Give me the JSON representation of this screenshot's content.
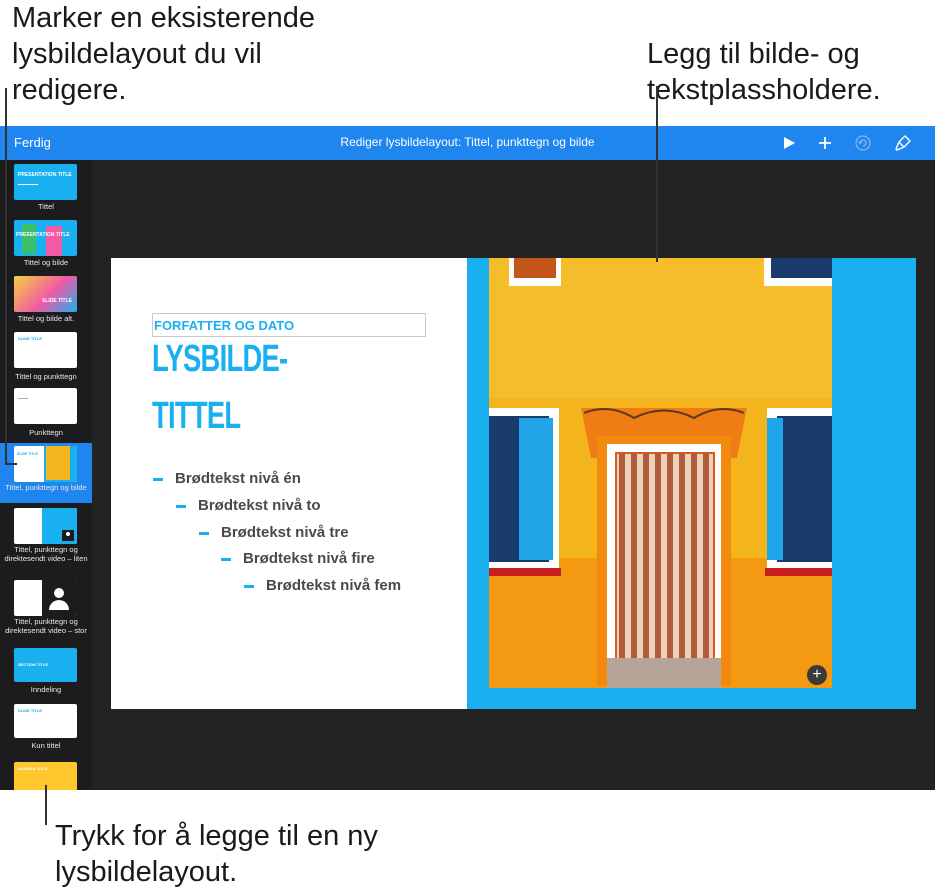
{
  "callouts": {
    "top_left": [
      "Marker en eksisterende",
      "lysbildelayout du vil",
      "redigere."
    ],
    "top_right": [
      "Legg til bilde- og",
      "tekstplassholdere."
    ],
    "bottom": [
      "Trykk for å legge til en ny",
      "lysbildelayout."
    ]
  },
  "toolbar": {
    "done_label": "Ferdig",
    "title": "Rediger lysbildelayout: Tittel, punkttegn og bilde",
    "icons": [
      "play-icon",
      "plus-icon",
      "undo-icon",
      "paintbrush-icon"
    ]
  },
  "sidebar": {
    "items": [
      {
        "label": "Tittel",
        "thumb_text": "PRESENTATION TITLE"
      },
      {
        "label": "Tittel og bilde",
        "thumb_text": "PRESENTATION TITLE"
      },
      {
        "label": "Tittel og bilde alt.",
        "thumb_text": "SLIDE TITLE"
      },
      {
        "label": "Tittel og punkttegn",
        "thumb_text": "SLIDE TITLE"
      },
      {
        "label": "Punkttegn",
        "thumb_text": ""
      },
      {
        "label": "Tittel, punkttegn og bilde",
        "thumb_text": "SLIDE TITLE"
      },
      {
        "label": "Tittel, punkttegn og direktesendt video – liten",
        "thumb_text": ""
      },
      {
        "label": "Tittel, punkttegn og direktesendt video – stor",
        "thumb_text": ""
      },
      {
        "label": "Inndeling",
        "thumb_text": "SECTION TITLE"
      },
      {
        "label": "Kun tittel",
        "thumb_text": "SLIDE TITLE"
      },
      {
        "label": "",
        "thumb_text": "AGENDA TITLE"
      }
    ],
    "selected_index": 5
  },
  "slide": {
    "author": "FORFATTER OG DATO",
    "title_line1": "LYSBILDE-",
    "title_line2": "TITTEL",
    "bullets": [
      "Brødtekst nivå én",
      "Brødtekst nivå to",
      "Brødtekst nivå tre",
      "Brødtekst nivå fire",
      "Brødtekst nivå fem"
    ],
    "add_image_icon": "plus-circle-icon"
  },
  "colors": {
    "toolbar": "#1f86f0",
    "accent": "#19b0ef",
    "sidebar_bg": "#1c1c1e",
    "canvas_bg": "#232324"
  }
}
